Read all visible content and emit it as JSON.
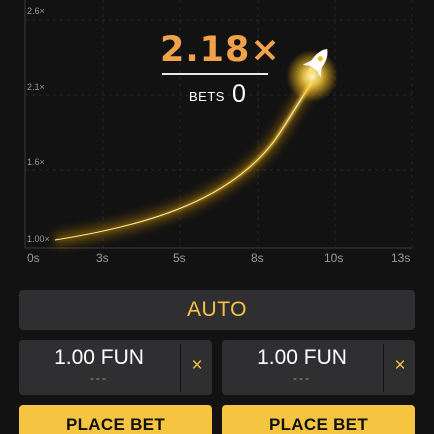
{
  "graph": {
    "y_labels": [
      "2.6×",
      "2.1×",
      "1.6×",
      "1.00×"
    ],
    "x_labels": [
      "0s",
      "3s",
      "5s",
      "8s",
      "10s",
      "13s"
    ]
  },
  "round": {
    "multiplier": "2.18×",
    "bets_label": "BETS",
    "bets_count": "0"
  },
  "controls": {
    "auto_label": "AUTO",
    "bets": [
      {
        "amount": "1.00 FUN",
        "sub": "---",
        "clear": "×",
        "place_label": "PLACE BET"
      },
      {
        "amount": "1.00 FUN",
        "sub": "---",
        "clear": "×",
        "place_label": "PLACE BET"
      }
    ]
  },
  "colors": {
    "multiplier": "#f0a14a",
    "accent": "#f5c244",
    "button": "#f5c542",
    "panel": "#2f2f31",
    "background": "#121212"
  },
  "icons": {
    "rocket": "rocket-icon"
  }
}
